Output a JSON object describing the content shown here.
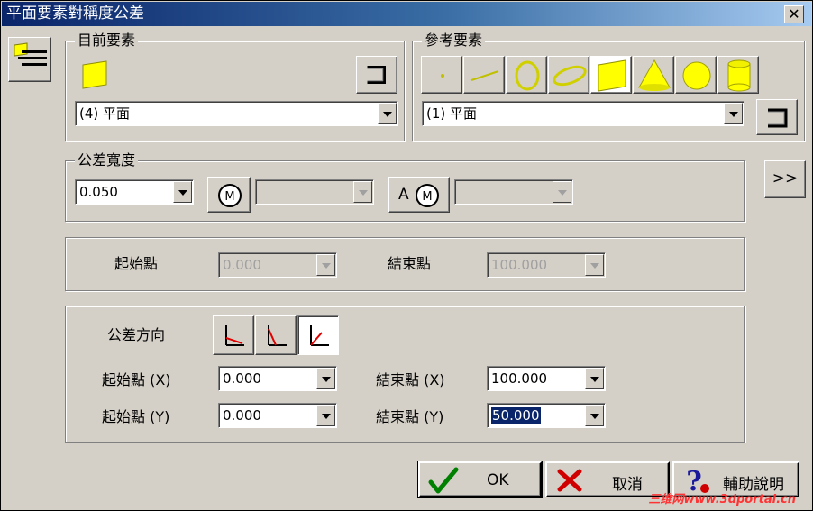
{
  "window": {
    "title": "平面要素對稱度公差",
    "close_glyph": "✕"
  },
  "current_element": {
    "group_label": "目前要素",
    "select_value": "(4) 平面"
  },
  "reference_element": {
    "group_label": "參考要素",
    "select_value": "(1) 平面",
    "types": [
      "point-icon",
      "line-icon",
      "circle-icon",
      "ellipse-icon",
      "plane-icon",
      "cone-icon",
      "sphere-icon",
      "cylinder-icon"
    ],
    "active_index": 4
  },
  "tolerance_width": {
    "group_label": "公差寬度",
    "value": "0.050",
    "modifier_prefix": "A"
  },
  "more_button": ">>",
  "range": {
    "start_label": "起始點",
    "start_value": "0.000",
    "end_label": "結束點",
    "end_value": "100.000"
  },
  "direction": {
    "label": "公差方向",
    "active_index": 2,
    "start_x_label": "起始點 (X)",
    "start_x_value": "0.000",
    "end_x_label": "結束點 (X)",
    "end_x_value": "100.000",
    "start_y_label": "起始點 (Y)",
    "start_y_value": "0.000",
    "end_y_label": "結束點 (Y)",
    "end_y_value": "50.000"
  },
  "buttons": {
    "ok": "OK",
    "cancel": "取消",
    "help": "輔助說明"
  },
  "watermark": "三维网www.3dportal.cn",
  "colors": {
    "accent_yellow": "#ffff00",
    "title_blue": "#0a246a",
    "ok_green": "#008000",
    "cancel_red": "#d00000",
    "help_blue": "#1a1a9a"
  }
}
